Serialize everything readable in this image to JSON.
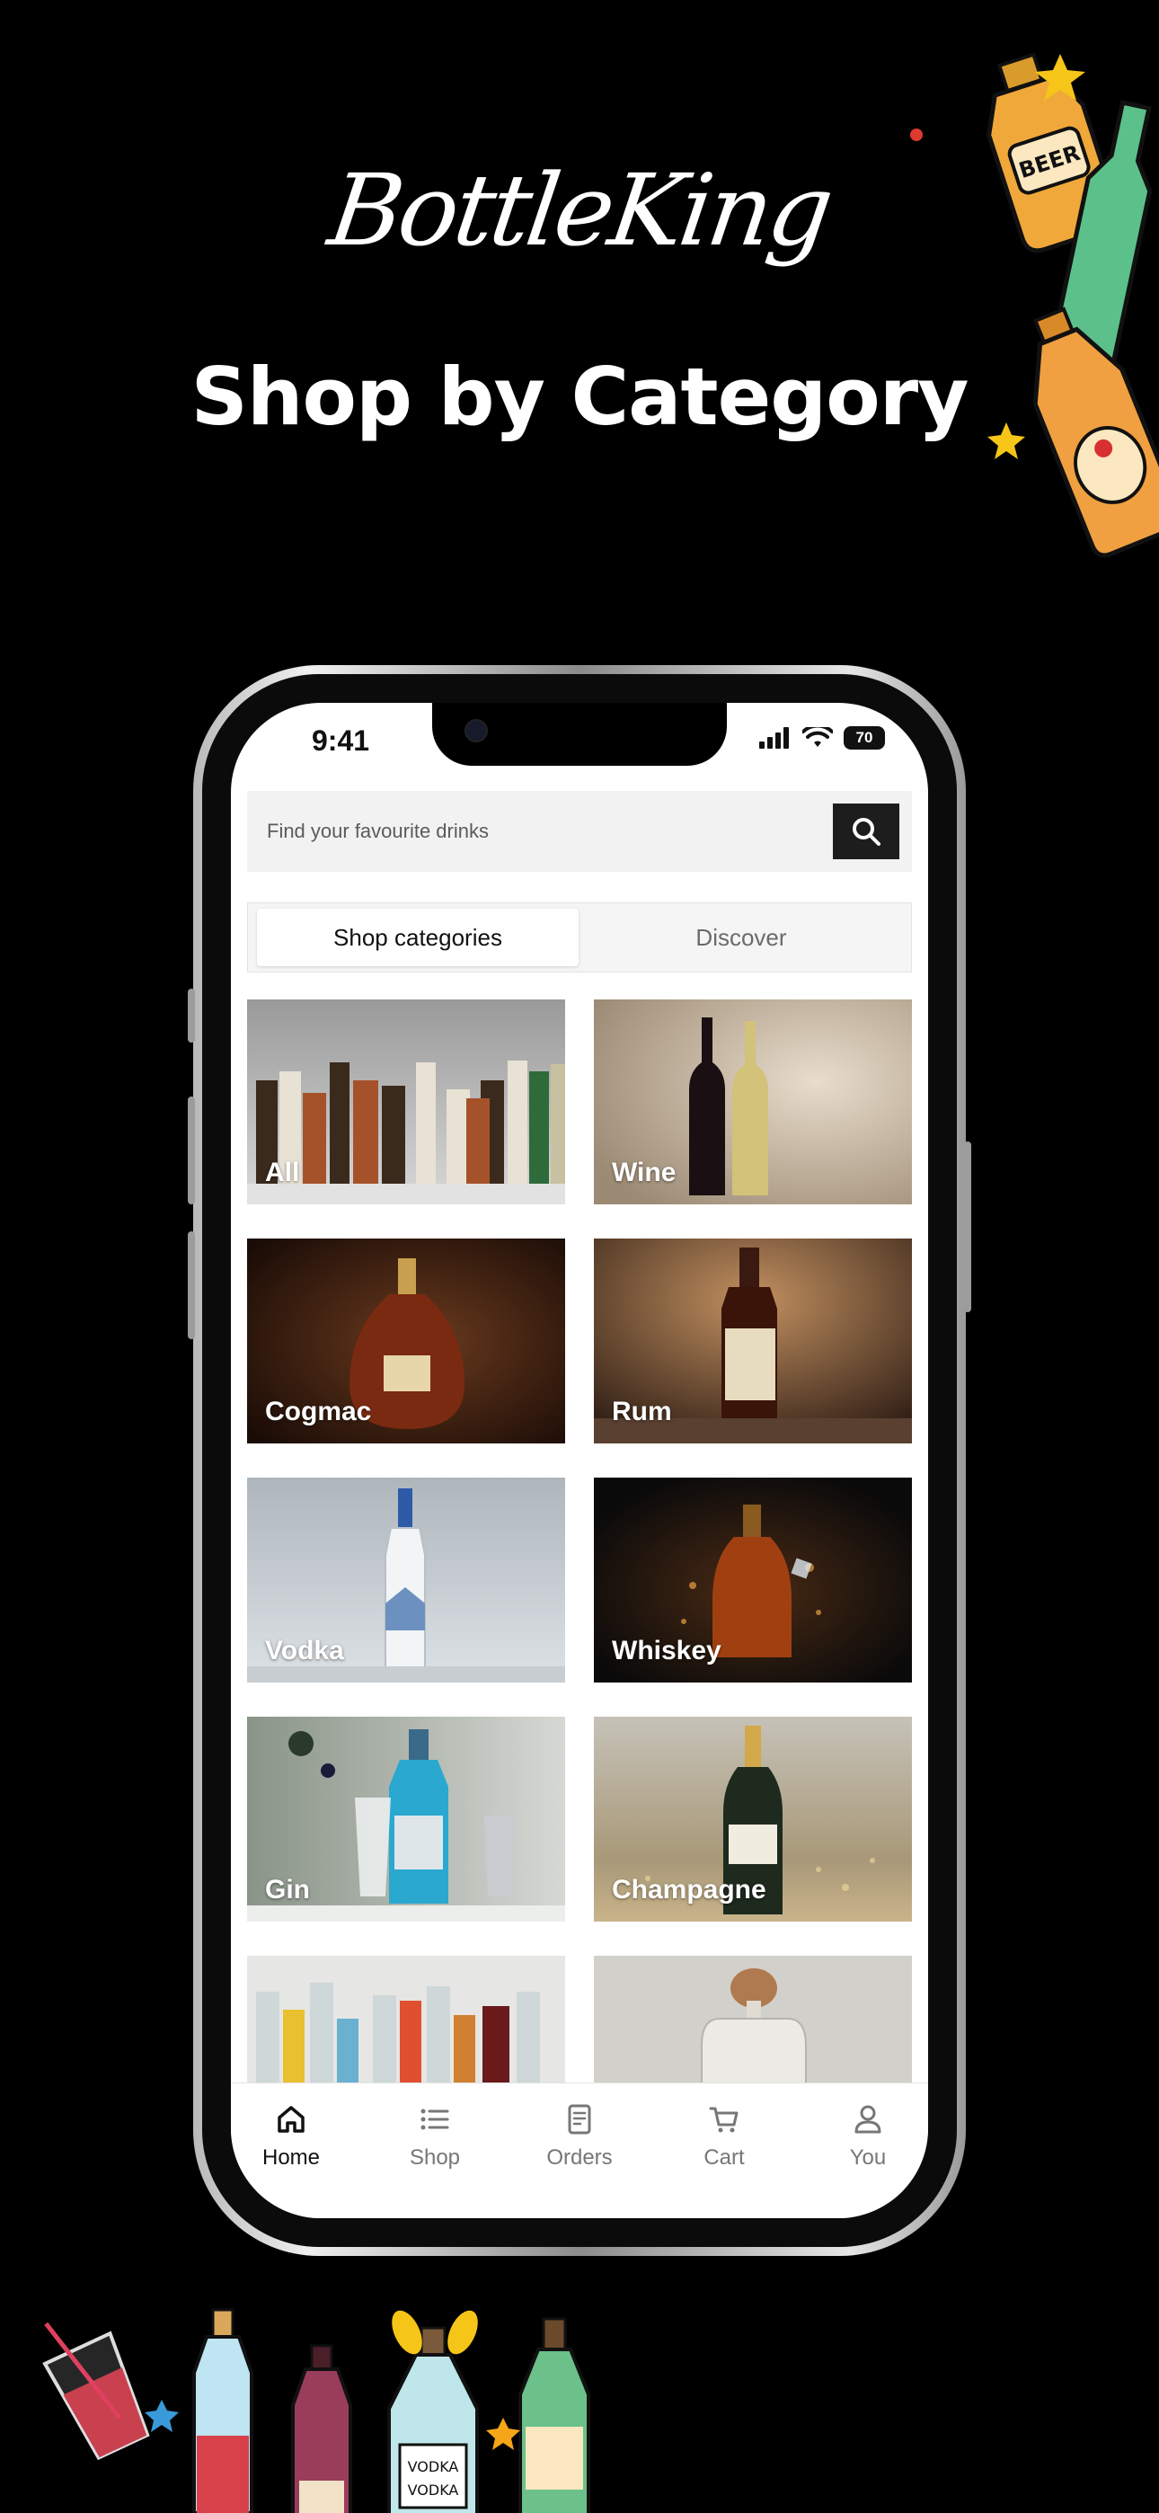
{
  "promo": {
    "brand": "BottleKing",
    "headline": "Shop by Category"
  },
  "status_bar": {
    "time": "9:41",
    "battery": "70"
  },
  "search": {
    "placeholder": "Find your favourite drinks"
  },
  "tabs": [
    {
      "label": "Shop categories",
      "active": true
    },
    {
      "label": "Discover",
      "active": false
    }
  ],
  "categories": [
    {
      "label": "All"
    },
    {
      "label": "Wine"
    },
    {
      "label": "Cogmac"
    },
    {
      "label": "Rum"
    },
    {
      "label": "Vodka"
    },
    {
      "label": "Whiskey"
    },
    {
      "label": "Gin"
    },
    {
      "label": "Champagne"
    },
    {
      "label": ""
    },
    {
      "label": ""
    }
  ],
  "bottom_nav": [
    {
      "label": "Home",
      "icon": "home-icon",
      "active": true
    },
    {
      "label": "Shop",
      "icon": "list-icon",
      "active": false
    },
    {
      "label": "Orders",
      "icon": "receipt-icon",
      "active": false
    },
    {
      "label": "Cart",
      "icon": "cart-icon",
      "active": false
    },
    {
      "label": "You",
      "icon": "user-icon",
      "active": false
    }
  ],
  "decorations": {
    "beer_label": "BEER",
    "vodka_label": "VODKA"
  }
}
